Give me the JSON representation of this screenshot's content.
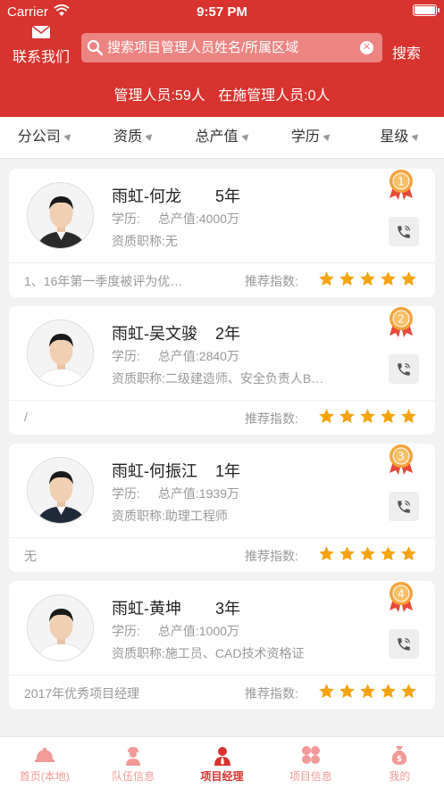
{
  "status_bar": {
    "carrier": "Carrier",
    "time": "9:57 PM"
  },
  "header": {
    "contact_label": "联系我们",
    "search_placeholder": "搜索项目管理人员姓名/所属区域",
    "search_button": "搜索",
    "stats_managers": "管理人员:59人",
    "stats_active": "在施管理人员:0人"
  },
  "filters": [
    "分公司",
    "资质",
    "总产值",
    "学历",
    "星级"
  ],
  "labels": {
    "education": "学历:",
    "output": "总产值:",
    "qualification": "资质职称:",
    "recommend": "推荐指数:"
  },
  "colors": {
    "brand": "#d8332f",
    "star": "#f5a30f",
    "rank": "#f3a33a"
  },
  "managers": [
    {
      "rank": "1",
      "name": "雨虹-何龙",
      "years": "5年",
      "education": "",
      "output": "4000万",
      "qualification": "无",
      "note": "1、16年第一季度被评为优…",
      "stars": 5,
      "shirt": "#2a2a2a"
    },
    {
      "rank": "2",
      "name": "雨虹-吴文骏",
      "years": "2年",
      "education": "",
      "output": "2840万",
      "qualification": "二级建造师、安全负责人B…",
      "note": "/",
      "stars": 5,
      "shirt": "#ffffff"
    },
    {
      "rank": "3",
      "name": "雨虹-何振江",
      "years": "1年",
      "education": "",
      "output": "1939万",
      "qualification": "助理工程师",
      "note": "无",
      "stars": 5,
      "shirt": "#1f2a3a"
    },
    {
      "rank": "4",
      "name": "雨虹-黄坤",
      "years": "3年",
      "education": "",
      "output": "1000万",
      "qualification": "施工员、CAD技术资格证",
      "note": "2017年优秀项目经理",
      "stars": 5,
      "shirt": "#ffffff"
    }
  ],
  "tabs": [
    {
      "label": "首页(本地)",
      "icon": "hardhat-icon",
      "active": false
    },
    {
      "label": "队伍信息",
      "icon": "worker-icon",
      "active": false
    },
    {
      "label": "项目经理",
      "icon": "manager-icon",
      "active": true
    },
    {
      "label": "项目信息",
      "icon": "grid-icon",
      "active": false
    },
    {
      "label": "我的",
      "icon": "moneybag-icon",
      "active": false
    }
  ]
}
